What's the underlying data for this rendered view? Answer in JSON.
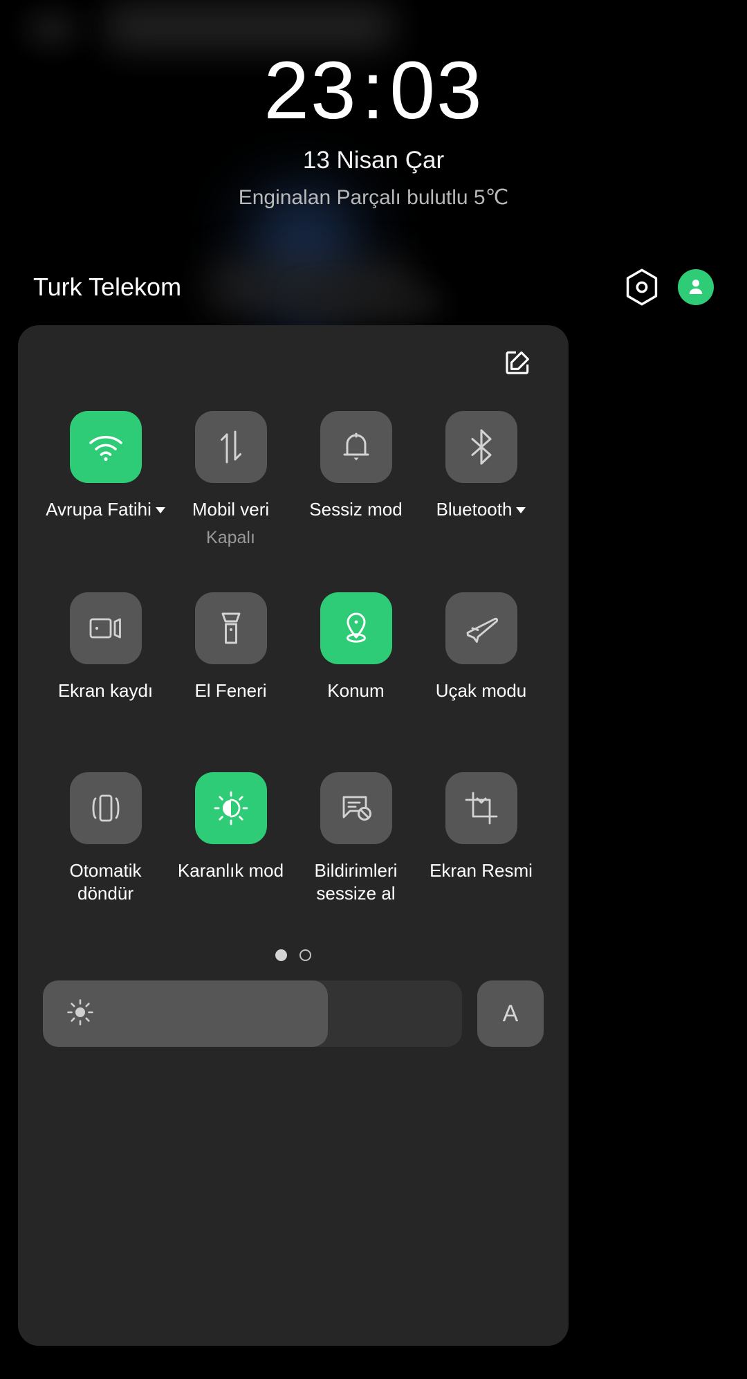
{
  "lockscreen": {
    "time_hours": "23",
    "time_separator": ":",
    "time_minutes": "03",
    "date": "13 Nisan Çar",
    "weather": "Enginalan Parçalı bulutlu 5℃"
  },
  "statusbar": {
    "carrier": "Turk Telekom",
    "settings_icon": "hexagon-settings-icon",
    "avatar_icon": "user-avatar-icon"
  },
  "quick_settings": {
    "edit_icon": "edit-pencil-icon",
    "tiles": [
      {
        "label": "Avrupa Fatihi",
        "sublabel": "",
        "icon": "wifi-icon",
        "active": true,
        "has_caret": true
      },
      {
        "label": "Mobil veri",
        "sublabel": "Kapalı",
        "icon": "mobile-data-icon",
        "active": false,
        "has_caret": false
      },
      {
        "label": "Sessiz mod",
        "sublabel": "",
        "icon": "bell-icon",
        "active": false,
        "has_caret": false
      },
      {
        "label": "Bluetooth",
        "sublabel": "",
        "icon": "bluetooth-icon",
        "active": false,
        "has_caret": true
      },
      {
        "label": "Ekran kaydı",
        "sublabel": "",
        "icon": "screen-record-icon",
        "active": false,
        "has_caret": false
      },
      {
        "label": "El Feneri",
        "sublabel": "",
        "icon": "flashlight-icon",
        "active": false,
        "has_caret": false
      },
      {
        "label": "Konum",
        "sublabel": "",
        "icon": "location-pin-icon",
        "active": true,
        "has_caret": false
      },
      {
        "label": "Uçak modu",
        "sublabel": "",
        "icon": "airplane-icon",
        "active": false,
        "has_caret": false
      },
      {
        "label": "Otomatik\ndöndür",
        "sublabel": "",
        "icon": "auto-rotate-icon",
        "active": false,
        "has_caret": false
      },
      {
        "label": "Karanlık mod",
        "sublabel": "",
        "icon": "dark-mode-icon",
        "active": true,
        "has_caret": false
      },
      {
        "label": "Bildirimleri\nsessize al",
        "sublabel": "",
        "icon": "mute-notifications-icon",
        "active": false,
        "has_caret": false
      },
      {
        "label": "Ekran Resmi",
        "sublabel": "",
        "icon": "screenshot-crop-icon",
        "active": false,
        "has_caret": false
      }
    ],
    "pages": {
      "count": 2,
      "current": 1
    },
    "brightness": {
      "icon": "brightness-sun-icon",
      "value_percent": 68,
      "auto_label": "A"
    }
  },
  "colors": {
    "accent_green": "#2ecc76",
    "panel_bg": "#262626",
    "tile_bg": "#565656",
    "screen_bg": "#000000"
  }
}
